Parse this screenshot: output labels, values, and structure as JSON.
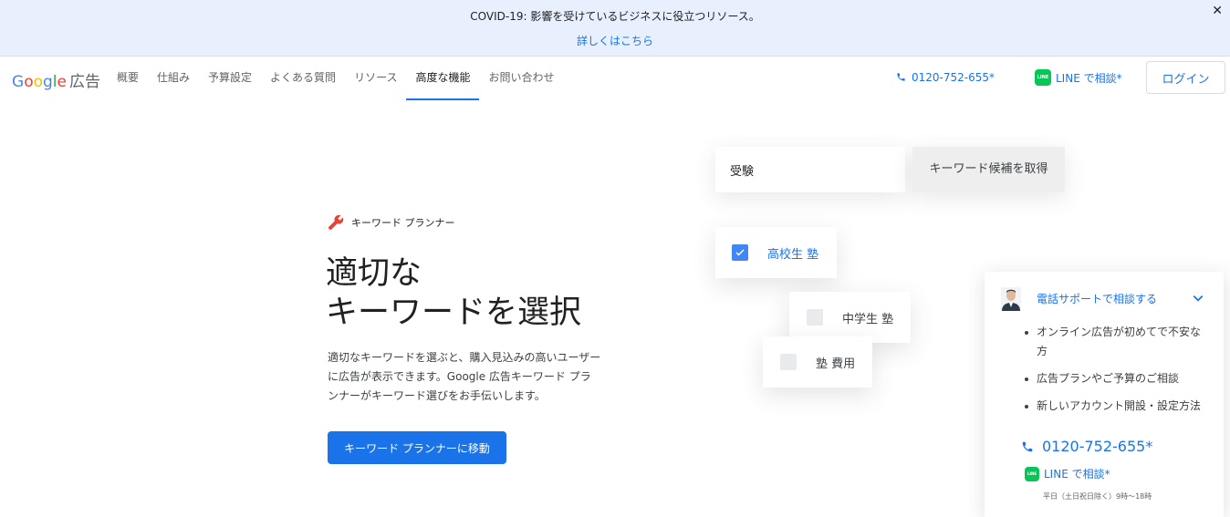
{
  "banner": {
    "text": "COVID-19: 影響を受けているビジネスに役立つリソース。",
    "link": "詳しくはこちら",
    "close": "✕"
  },
  "nav": {
    "logo_g": [
      "G",
      "o",
      "o",
      "g",
      "l",
      "e"
    ],
    "logo_ads": "広告",
    "links": [
      "概要",
      "仕組み",
      "予算設定",
      "よくある質問",
      "リソース",
      "高度な機能",
      "お問い合わせ"
    ],
    "active_index": 5,
    "phone": "0120-752-655*",
    "line_icon": "LINE",
    "line": "LINE で相談*",
    "login": "ログイン"
  },
  "hero": {
    "label": "キーワード プランナー",
    "title_line1": "適切な",
    "title_line2": "キーワードを選択",
    "description": "適切なキーワードを選ぶと、購入見込みの高いユーザーに広告が表示できます。Google 広告キーワード プランナーがキーワード選びをお手伝いします。",
    "cta": "キーワード プランナーに移動"
  },
  "illustration": {
    "input_value": "受験",
    "button": "キーワード候補を取得",
    "chips": [
      {
        "label": "高校生 塾",
        "checked": true
      },
      {
        "label": "中学生 塾",
        "checked": false
      },
      {
        "label": "塾 費用",
        "checked": false
      }
    ]
  },
  "support": {
    "title": "電話サポートで相談する",
    "items": [
      "オンライン広告が初めてで不安な方",
      "広告プランやご予算のご相談",
      "新しいアカウント開設・設定方法"
    ],
    "phone": "0120-752-655*",
    "line": "LINE で相談*",
    "hours": "平日（土日祝日除く）9時～18時"
  },
  "colors": {
    "brand_blue": "#1a73e8",
    "banner_bg": "#e8f0fe",
    "line_green": "#06c755",
    "checkbox_blue": "#4285f4"
  }
}
